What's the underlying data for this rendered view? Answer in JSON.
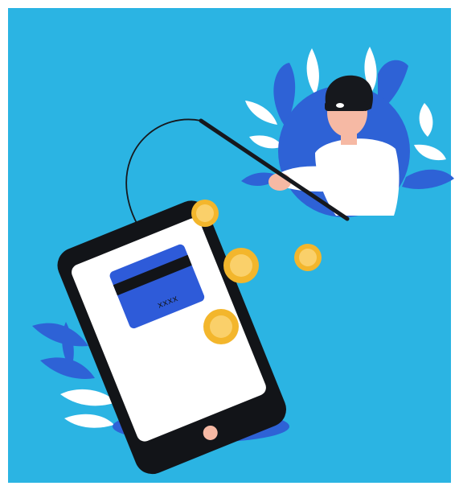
{
  "card": {
    "number_text": "xxxx"
  },
  "colors": {
    "background": "#2BB4E3",
    "page_border": "#ffffff",
    "leaf_blue": "#2E62D6",
    "leaf_white": "#ffffff",
    "phone_body": "#121418",
    "phone_screen": "#ffffff",
    "card_blue": "#2E5BD9",
    "coin_gold": "#F3B62C",
    "coin_light": "#FAD06A",
    "skin": "#F6B9A4",
    "hacker_shirt": "#ffffff",
    "hacker_hat": "#16181D"
  },
  "icons": [
    "hacker-figure",
    "fishing-rod",
    "smartphone",
    "credit-card",
    "gold-coin",
    "leaf"
  ]
}
